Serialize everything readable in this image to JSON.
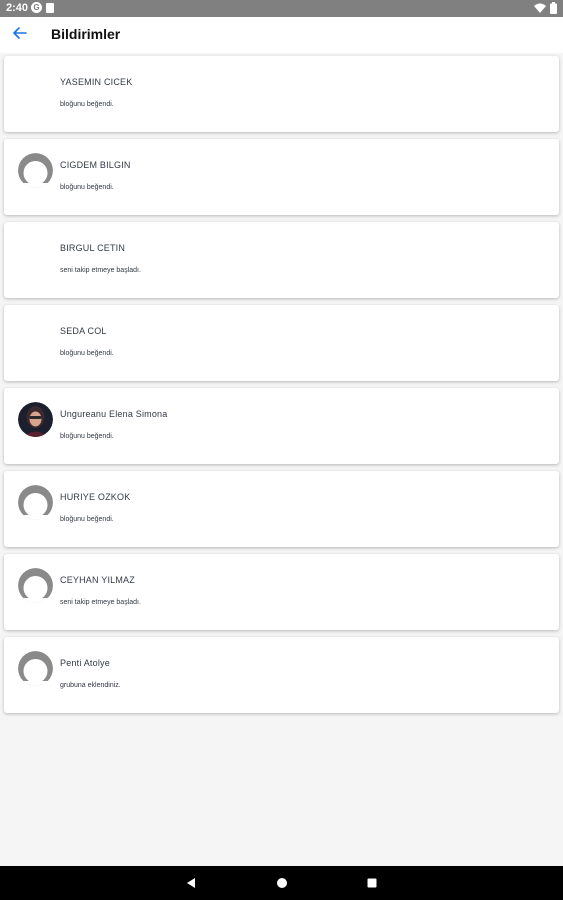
{
  "status_bar": {
    "time": "2:40",
    "left_icons": [
      "google-icon",
      "sim-card-icon"
    ],
    "right_icons": [
      "wifi-icon",
      "battery-icon"
    ]
  },
  "app_bar": {
    "title": "Bildirimler",
    "back_icon": "arrow-left-icon",
    "accent_color": "#1a73e8"
  },
  "notifications": [
    {
      "name": "YASEMIN CICEK",
      "message": " bloğunu beğendi.",
      "avatar": "none"
    },
    {
      "name": "CIGDEM BILGIN",
      "message": " bloğunu beğendi.",
      "avatar": "default"
    },
    {
      "name": "BIRGUL CETIN",
      "message": "seni takip etmeye başladı.",
      "avatar": "none"
    },
    {
      "name": "SEDA COL",
      "message": " bloğunu beğendi.",
      "avatar": "none"
    },
    {
      "name": "Ungureanu Elena Simona",
      "message": " bloğunu beğendi.",
      "avatar": "photo"
    },
    {
      "name": "HURIYE OZKOK",
      "message": " bloğunu beğendi.",
      "avatar": "default"
    },
    {
      "name": "CEYHAN YILMAZ",
      "message": "seni takip etmeye başladı.",
      "avatar": "default"
    },
    {
      "name": "Penti Atolye",
      "message": " grubuna eklendiniz.",
      "avatar": "default"
    }
  ],
  "nav_bar": {
    "buttons": [
      "back-triangle-icon",
      "home-circle-icon",
      "recents-square-icon"
    ]
  }
}
